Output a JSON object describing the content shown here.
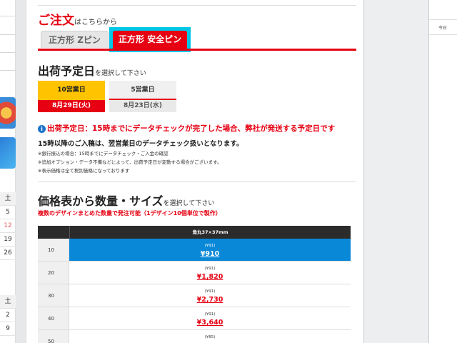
{
  "order": {
    "title": "ご注文",
    "subtitle": "はこちらから"
  },
  "tabs": [
    {
      "label": "正方形 Zピン",
      "active": false
    },
    {
      "label": "正方形 安全ピン",
      "active": true
    }
  ],
  "shipping": {
    "title": "出荷予定日",
    "subtitle": "を選択して下さい",
    "options": [
      {
        "days": "10営業日",
        "date": "8月29日(火)",
        "selected": true
      },
      {
        "days": "5営業日",
        "date": "8月23日(水)",
        "selected": false
      }
    ],
    "notice_icon": "info-icon",
    "notice": "出荷予定日：15時までにデータチェックが完了した場合、弊社が発送する予定日です",
    "note_bold": "15時以降のご入稿は、翌営業日のデータチェック扱いとなります。",
    "notes": [
      "※銀行振込の場合：15時までにデータチェック・ご入金の確認",
      "※追加オプション・データ不備などによって、出荷予定日が変動する場合がございます。",
      "※表示価格は全て税別価格になっております"
    ]
  },
  "pricing": {
    "title": "価格表から数量・サイズ",
    "subtitle": "を選択して下さい",
    "bulk_note": "複数のデザインまとめた数量で発注可能（1デザイン10個単位で製作）",
    "column_header": "角丸37×37mm",
    "rows": [
      {
        "qty": "10",
        "unit": "(¥91)",
        "total": "¥910",
        "selected": true
      },
      {
        "qty": "20",
        "unit": "(¥91)",
        "total": "¥1,820",
        "selected": false
      },
      {
        "qty": "30",
        "unit": "(¥91)",
        "total": "¥2,730",
        "selected": false
      },
      {
        "qty": "40",
        "unit": "(¥91)",
        "total": "¥3,640",
        "selected": false
      },
      {
        "qty": "50",
        "unit": "(¥85)",
        "total": "",
        "selected": false
      }
    ]
  },
  "calendar": {
    "week1": [
      "土",
      "5",
      "12",
      "19",
      "26"
    ],
    "week2": [
      "土",
      "2",
      "9"
    ]
  },
  "right_pane": {
    "today_label": "今日"
  },
  "colors": {
    "accent": "#e60012",
    "selected_blue": "#0a88d8",
    "highlight": "#00c7e8",
    "yellow": "#ffc300"
  }
}
